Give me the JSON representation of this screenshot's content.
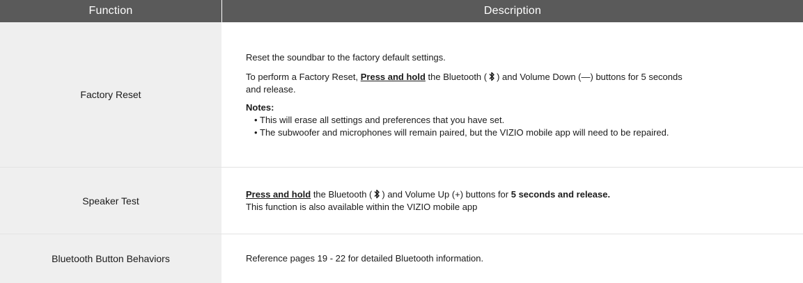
{
  "header": {
    "function_label": "Function",
    "description_label": "Description"
  },
  "rows": [
    {
      "function": "Factory Reset",
      "line1": "Reset the soundbar to the factory default settings.",
      "line2_pre": "To perform a Factory Reset, ",
      "line2_bold": "Press and hold",
      "line2_mid": " the Bluetooth (",
      "line2_post": ") and Volume Down (—) buttons for 5 seconds",
      "line2_cont": "and release.",
      "notes_title": "Notes:",
      "notes": [
        "This will erase all settings and preferences that you have set.",
        "The subwoofer and microphones will remain paired, but the VIZIO mobile app will need to be repaired."
      ]
    },
    {
      "function": "Speaker Test",
      "line1_bold": "Press and hold",
      "line1_mid": " the Bluetooth (",
      "line1_post": ") and Volume Up (+) buttons for ",
      "line1_end_bold": "5 seconds and release.",
      "line2": "This function is also available within the VIZIO mobile app"
    },
    {
      "function": "Bluetooth Button Behaviors",
      "line1": "Reference pages 19 - 22 for detailed Bluetooth information."
    }
  ]
}
